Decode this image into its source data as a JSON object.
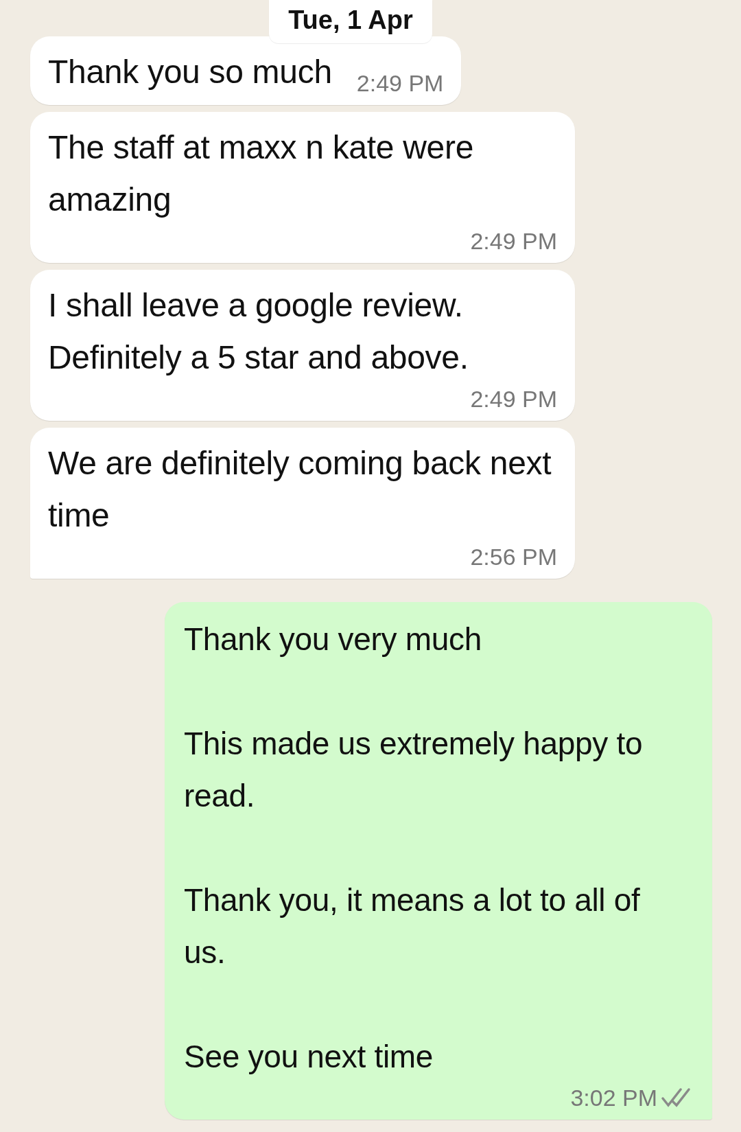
{
  "date_chip": "Tue, 1 Apr",
  "messages": [
    {
      "kind": "incoming",
      "text": "Thank you so much",
      "time": "2:49 PM",
      "tail": false
    },
    {
      "kind": "incoming",
      "text": "The staff at maxx n kate were amazing",
      "time": "2:49 PM",
      "tail": false
    },
    {
      "kind": "incoming",
      "text": "I shall leave a google review. Definitely a 5 star and above.",
      "time": "2:49 PM",
      "tail": false
    },
    {
      "kind": "incoming",
      "text": "We are definitely coming back next time",
      "time": "2:56 PM",
      "tail": true
    },
    {
      "kind": "outgoing",
      "text": "Thank you very much\n\nThis made us extremely happy to read.\n\nThank you, it means a lot to all of us.\n\nSee you next time",
      "time": "3:02 PM",
      "tail": true,
      "read": false
    }
  ]
}
